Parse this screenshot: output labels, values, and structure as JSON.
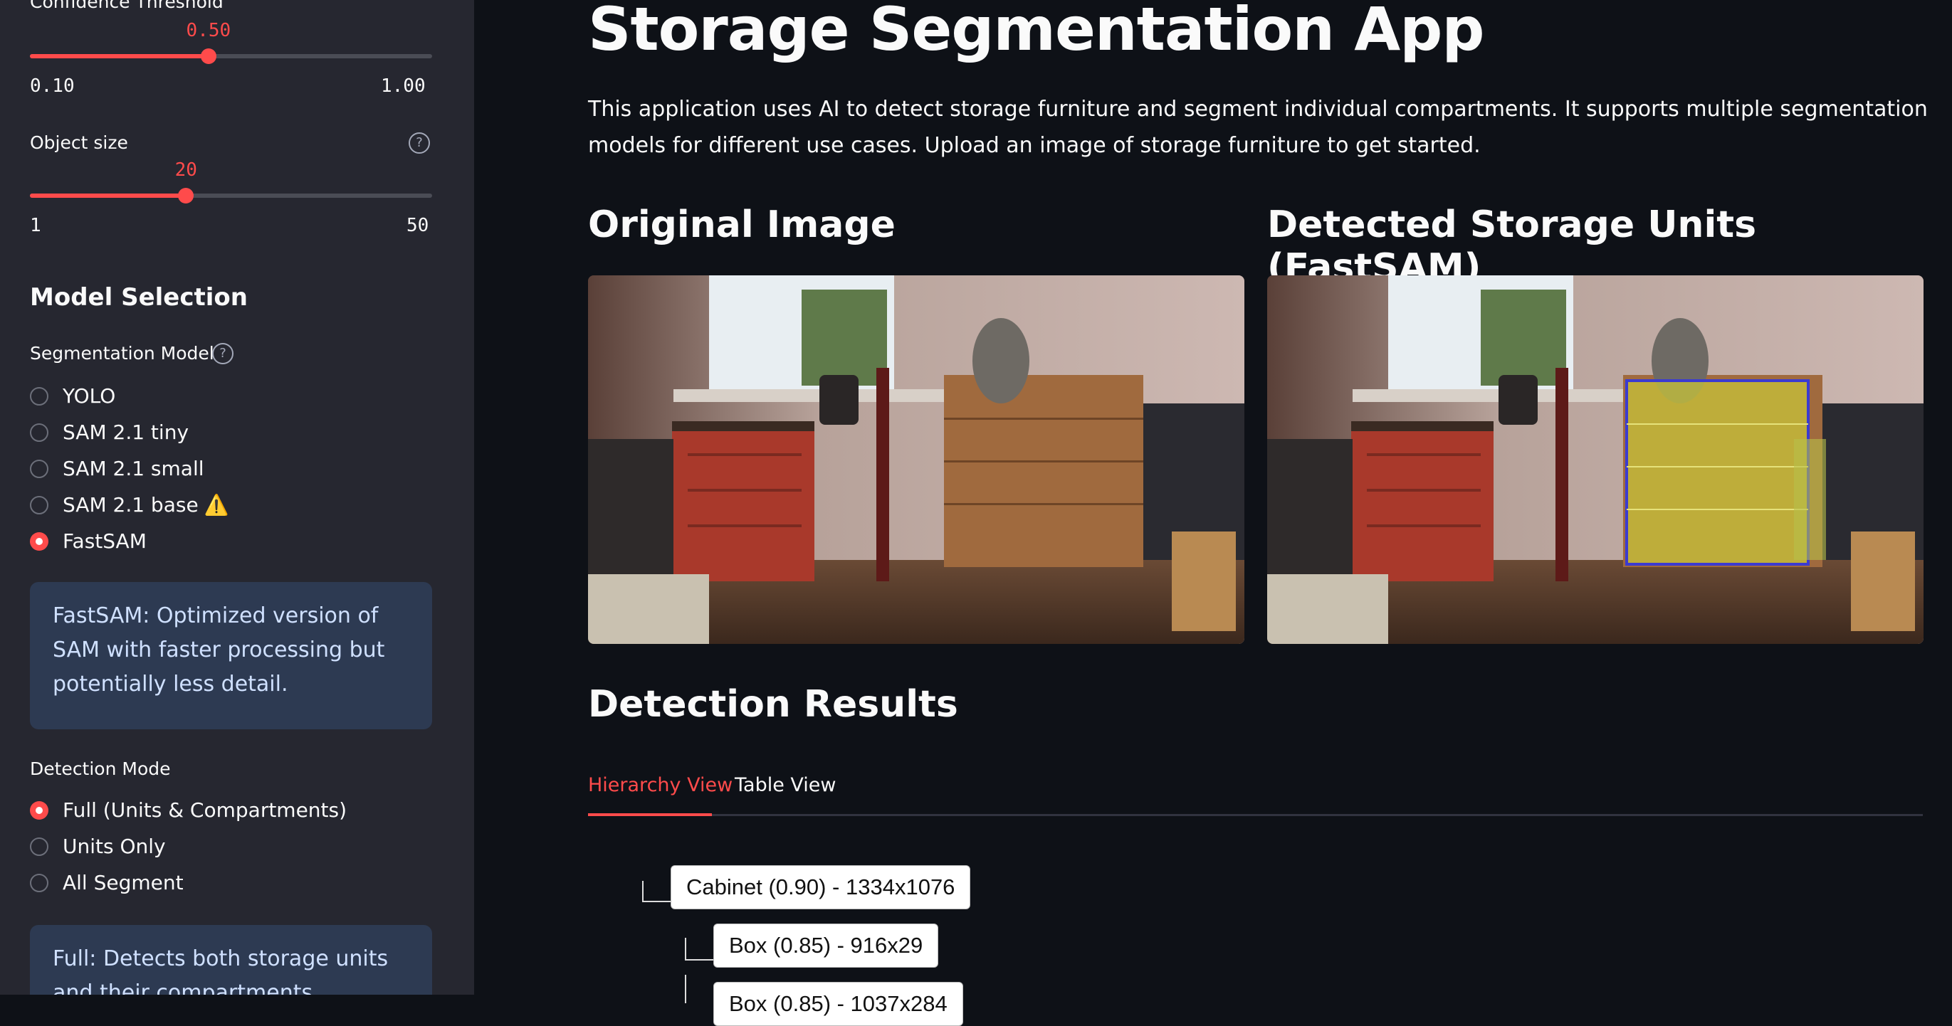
{
  "sidebar": {
    "confidence": {
      "label": "Confidence Threshold",
      "value": "0.50",
      "value_fraction": 0.444,
      "min": "0.10",
      "max": "1.00"
    },
    "object_size": {
      "label": "Object size",
      "value": "20",
      "value_fraction": 0.388,
      "min": "1",
      "max": "50",
      "help_icon": "question-circle-icon"
    },
    "model_section_title": "Model Selection",
    "segmentation_model": {
      "label": "Segmentation Model",
      "help_icon": "question-circle-icon",
      "options": [
        "YOLO",
        "SAM 2.1 tiny",
        "SAM 2.1 small",
        "SAM 2.1 base",
        "FastSAM"
      ],
      "warning_icon": "⚠️",
      "selected": "FastSAM"
    },
    "model_info": "FastSAM: Optimized version of SAM with faster processing but potentially less detail.",
    "detection_mode": {
      "label": "Detection Mode",
      "options": [
        "Full (Units & Compartments)",
        "Units Only",
        "All Segment"
      ],
      "selected": "Full (Units & Compartments)"
    },
    "mode_info": "Full: Detects both storage units and their compartments"
  },
  "main": {
    "title": "Storage Segmentation App",
    "description": "This application uses AI to detect storage furniture and segment individual compartments. It supports multiple segmentation models for different use cases. Upload an image of storage furniture to get started.",
    "original_title": "Original Image",
    "detected_title": "Detected Storage Units (FastSAM)",
    "results_title": "Detection Results",
    "tabs": [
      "Hierarchy View",
      "Table View"
    ],
    "active_tab": "Hierarchy View",
    "hierarchy": [
      {
        "label": "Cabinet (0.90) - 1334x1076"
      },
      {
        "label": "Box (0.85) - 916x29"
      },
      {
        "label": "Box (0.85) - 1037x284"
      }
    ]
  },
  "colors": {
    "accent": "#ff4b4b",
    "sidebar_bg": "#262730",
    "main_bg": "#0e1117",
    "info_bg": "#2d3a52",
    "mask": "#c8c43a"
  }
}
